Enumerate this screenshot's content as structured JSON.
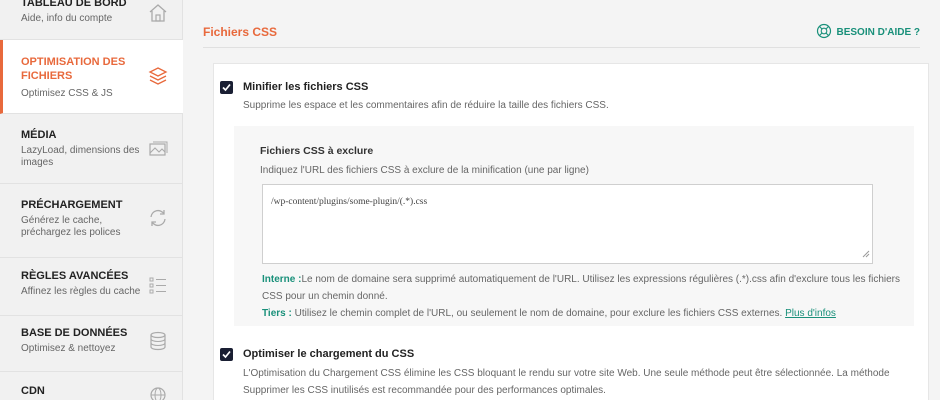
{
  "sidebar": {
    "items": [
      {
        "title": "TABLEAU DE BORD",
        "subtitle": "Aide, info du compte",
        "icon": "home-icon"
      },
      {
        "title": "OPTIMISATION DES FICHIERS",
        "subtitle": "Optimisez CSS & JS",
        "icon": "layers-icon",
        "active": true
      },
      {
        "title": "MÉDIA",
        "subtitle": "LazyLoad, dimensions des images",
        "icon": "image-icon"
      },
      {
        "title": "PRÉCHARGEMENT",
        "subtitle": "Générez le cache, préchargez les polices",
        "icon": "refresh-icon"
      },
      {
        "title": "RÈGLES AVANCÉES",
        "subtitle": "Affinez les règles du cache",
        "icon": "list-icon"
      },
      {
        "title": "BASE DE DONNÉES",
        "subtitle": "Optimisez & nettoyez",
        "icon": "database-icon"
      },
      {
        "title": "CDN",
        "subtitle": "",
        "icon": "globe-icon"
      }
    ]
  },
  "main": {
    "section_title": "Fichiers CSS",
    "help_label": "BESOIN D'AIDE ?",
    "minify": {
      "label": "Minifier les fichiers CSS",
      "description": "Supprime les espace et les commentaires afin de réduire la taille des fichiers CSS.",
      "checked": true
    },
    "exclude": {
      "title": "Fichiers CSS à exclure",
      "description": "Indiquez l'URL des fichiers CSS à exclure de la minification (une par ligne)",
      "value": "/wp-content/plugins/some-plugin/(.*).css",
      "help_internal_label": "Interne :",
      "help_internal_text": "Le nom de domaine sera supprimé automatiquement de l'URL. Utilisez les expressions régulières (.*).css afin d'exclure tous les fichiers CSS pour un chemin donné.",
      "help_thirdparty_label": "Tiers :",
      "help_thirdparty_text": " Utilisez le chemin complet de l'URL, ou seulement le nom de domaine, pour exclure les fichiers CSS externes. ",
      "more_link": "Plus d'infos"
    },
    "optimize": {
      "label": "Optimiser le chargement du CSS",
      "description": "L'Optimisation du Chargement CSS élimine les CSS bloquant le rendu sur votre site Web. Une seule méthode peut être sélectionnée. La méthode Supprimer les CSS inutilisés est recommandée pour des performances optimales.",
      "checked": true
    }
  },
  "colors": {
    "accent": "#e8693c",
    "link": "#19907a",
    "checkbox": "#1a1f33"
  }
}
